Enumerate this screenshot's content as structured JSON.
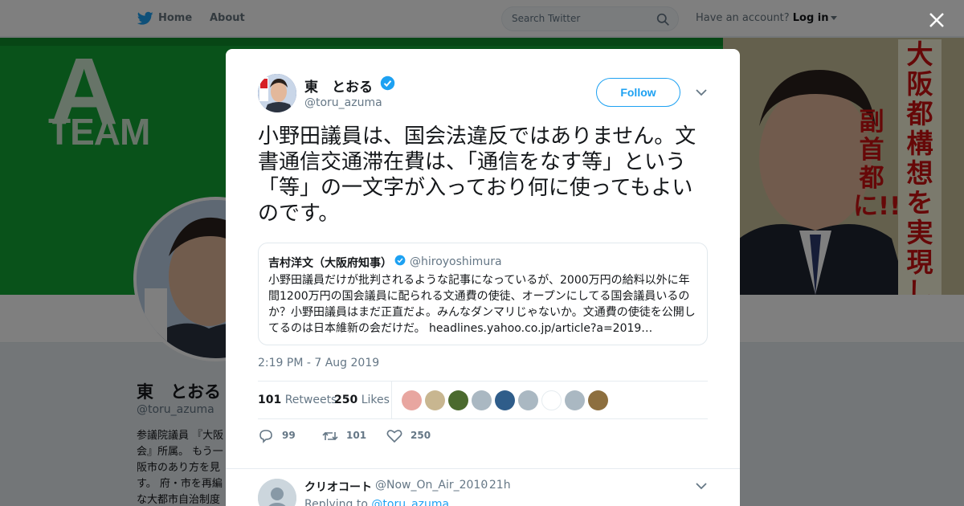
{
  "nav": {
    "home": "Home",
    "about": "About",
    "search_placeholder": "Search Twitter",
    "account_question": "Have an account?",
    "login": "Log in"
  },
  "banner": {
    "a": "A",
    "team": "TEAM",
    "slogan_right": "大阪都構想を実現し",
    "slogan_left": "副首都に!!"
  },
  "profile": {
    "name": "東　とおる",
    "handle": "@toru_azuma",
    "bio": "参議院議員 『大阪\n会』所属。 もう一\n阪市のあり方を見\nす。 府・市を再編\nな大都市自治制度"
  },
  "tweet": {
    "author_name": "東　とおる",
    "author_handle": "@toru_azuma",
    "follow_label": "Follow",
    "text": "小野田議員は、国会法違反ではありません。文書通信交通滞在費は、「通信をなす等」という「等」の一文字が入っており何に使ってもよいのです。",
    "timestamp": "2:19 PM - 7 Aug 2019",
    "retweets_count": "101",
    "retweets_label": "Retweets",
    "likes_count": "250",
    "likes_label": "Likes",
    "reply_count": "99",
    "retweet_count_action": "101",
    "like_count_action": "250"
  },
  "quote": {
    "name": "吉村洋文（大阪府知事）",
    "handle": "@hiroyoshimura",
    "text": "小野田議員だけが批判されるような記事になっているが、2000万円の給料以外に年間1200万円の国会議員に配られる文通費の使徒、オープンにしてる国会議員いるのか？小野田議員はまだ正直だよ。みんなダンマリじゃないか。文通費の使徒を公開してるのは日本維新の会だけだ。 headlines.yahoo.co.jp/article?a=2019…"
  },
  "likers": [
    {
      "name": "liker-avatar",
      "color": "#e8a6a0"
    },
    {
      "name": "liker-avatar",
      "color": "#c8b690"
    },
    {
      "name": "liker-avatar",
      "color": "#4b6a2e"
    },
    {
      "name": "liker-avatar",
      "color": "#aab8c2"
    },
    {
      "name": "liker-avatar",
      "color": "#2f5d8a"
    },
    {
      "name": "liker-avatar",
      "color": "#aab8c2"
    },
    {
      "name": "liker-avatar",
      "color": "#ffffff"
    },
    {
      "name": "liker-avatar",
      "color": "#aab8c2"
    },
    {
      "name": "liker-avatar",
      "color": "#8d6f3f"
    }
  ],
  "reply": {
    "name": "クリオコート",
    "handle": "@Now_On_Air_2010",
    "time": "· 21h",
    "replying_prefix": "Replying to",
    "replying_to": "@toru_azuma"
  },
  "colors": {
    "twitter_blue": "#1da1f2",
    "banner_green": "#13a535",
    "slogan_red": "#cc1111"
  }
}
